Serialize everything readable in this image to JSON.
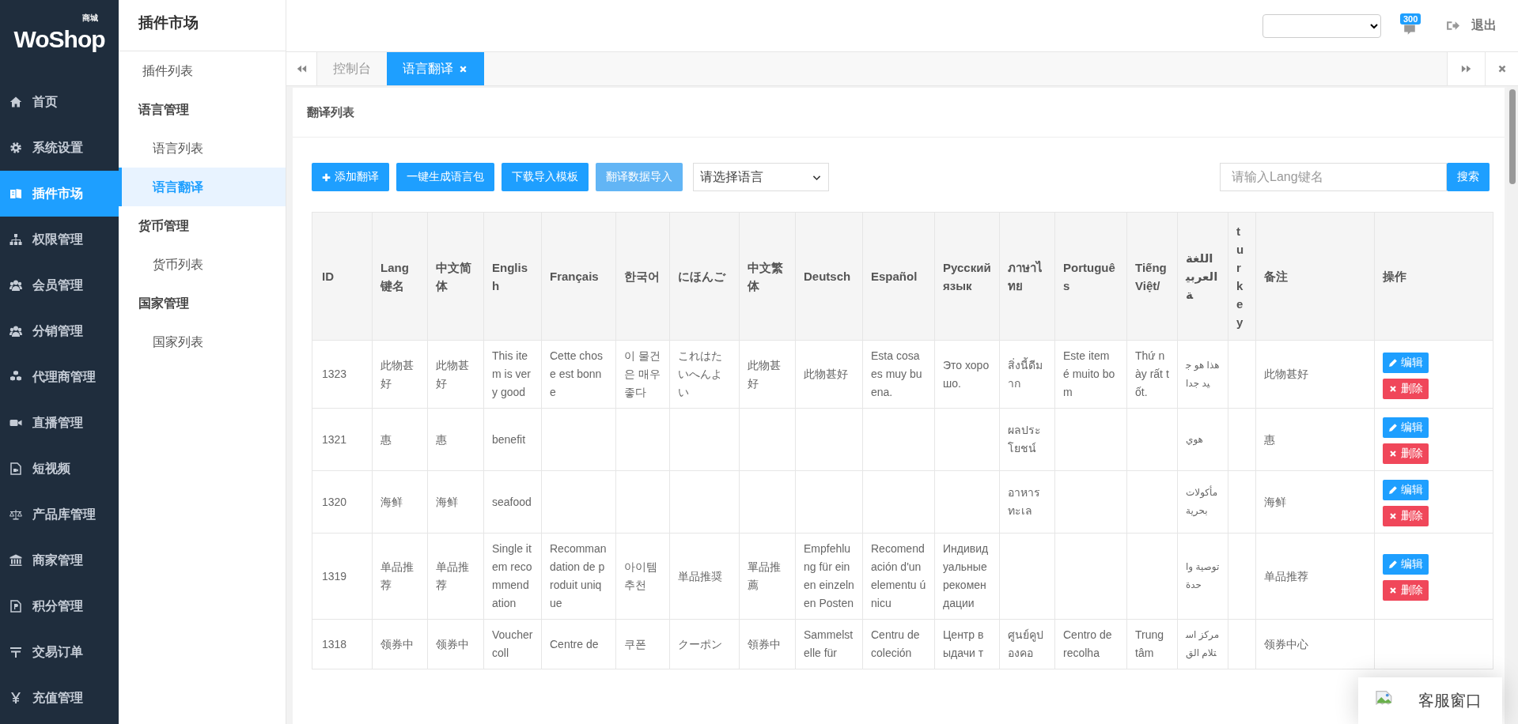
{
  "logo": {
    "text": "WoShop",
    "badge": "商城"
  },
  "sidebar": {
    "items": [
      {
        "label": "首页",
        "selected": false
      },
      {
        "label": "系统设置",
        "selected": false
      },
      {
        "label": "插件市场",
        "selected": true
      },
      {
        "label": "权限管理",
        "selected": false
      },
      {
        "label": "会员管理",
        "selected": false
      },
      {
        "label": "分销管理",
        "selected": false
      },
      {
        "label": "代理商管理",
        "selected": false
      },
      {
        "label": "直播管理",
        "selected": false
      },
      {
        "label": "短视频",
        "selected": false
      },
      {
        "label": "产品库管理",
        "selected": false
      },
      {
        "label": "商家管理",
        "selected": false
      },
      {
        "label": "积分管理",
        "selected": false
      },
      {
        "label": "交易订单",
        "selected": false
      },
      {
        "label": "充值管理",
        "selected": false
      }
    ]
  },
  "subnav": {
    "title": "插件市场",
    "sections": [
      {
        "items": [
          {
            "label": "插件列表",
            "selected": false
          }
        ]
      },
      {
        "heading": "语言管理",
        "items": [
          {
            "label": "语言列表",
            "selected": false
          },
          {
            "label": "语言翻译",
            "selected": true
          }
        ]
      },
      {
        "heading": "货币管理",
        "items": [
          {
            "label": "货币列表",
            "selected": false
          }
        ]
      },
      {
        "heading": "国家管理",
        "items": [
          {
            "label": "国家列表",
            "selected": false
          }
        ]
      }
    ]
  },
  "header": {
    "notification_count": "300",
    "logout": "退出"
  },
  "tabs": [
    {
      "label": "控制台",
      "selected": false,
      "closable": false
    },
    {
      "label": "语言翻译",
      "selected": true,
      "closable": true
    }
  ],
  "panel": {
    "title": "翻译列表",
    "buttons": [
      {
        "label": "添加翻译",
        "kind": "add",
        "disabled": false
      },
      {
        "label": "一键生成语言包",
        "kind": "plain",
        "disabled": false
      },
      {
        "label": "下载导入模板",
        "kind": "plain",
        "disabled": false
      },
      {
        "label": "翻译数据导入",
        "kind": "plain",
        "disabled": true
      }
    ],
    "language_select": {
      "value": "请选择语言"
    },
    "search": {
      "placeholder": "请输入Lang键名",
      "button": "搜索"
    }
  },
  "table": {
    "columns": [
      "ID",
      "Lang键名",
      "中文简体",
      "English",
      "Français",
      "한국어",
      "にほんご",
      "中文繁体",
      "Deutsch",
      "Español",
      "Русский язык",
      "ภาษาไทย",
      "Português",
      "Tiếng Việt/",
      "اللغة العربية",
      "turkey",
      "备注",
      "操作"
    ],
    "rows": [
      {
        "cells": [
          "1323",
          "此物甚好",
          "此物甚好",
          "This item is very good",
          "Cette chose est bonne",
          "이 물건은 매우 좋다",
          "これはたいへんよい",
          "此物甚好",
          "此物甚好",
          "Esta cosa es muy buena.",
          "Это хорошо.",
          "สิ่งนี้ดีมาก",
          "Este item é muito bom",
          "Thứ này rất tốt.",
          "هذا هو جيد جدا",
          null,
          "此物甚好"
        ],
        "actions": [
          {
            "label": "编辑",
            "kind": "edit"
          },
          {
            "label": "删除",
            "kind": "delete"
          }
        ]
      },
      {
        "cells": [
          "1321",
          "惠",
          "惠",
          "benefit",
          null,
          null,
          null,
          null,
          null,
          null,
          null,
          "ผลประโยชน์",
          null,
          null,
          "هوي",
          null,
          "惠"
        ],
        "actions": [
          {
            "label": "编辑",
            "kind": "edit"
          },
          {
            "label": "删除",
            "kind": "delete"
          }
        ]
      },
      {
        "cells": [
          "1320",
          "海鲜",
          "海鲜",
          "seafood",
          null,
          null,
          null,
          null,
          null,
          null,
          null,
          "อาหารทะเล",
          null,
          null,
          "مأكولات بحرية",
          null,
          "海鲜"
        ],
        "actions": [
          {
            "label": "编辑",
            "kind": "edit"
          },
          {
            "label": "删除",
            "kind": "delete"
          }
        ]
      },
      {
        "cells": [
          "1319",
          "单品推荐",
          "单品推荐",
          "Single item recommendation",
          "Recommandation de produit unique",
          "아이템 추천",
          "単品推奨",
          "單品推薦",
          "Empfehlung für einen einzelnen Posten",
          "Recomendación d'un elementu únicu",
          "Индивидуальные рекомендации",
          null,
          null,
          null,
          "توصية واحدة",
          null,
          "单品推荐"
        ],
        "actions": [
          {
            "label": "编辑",
            "kind": "edit"
          },
          {
            "label": "删除",
            "kind": "delete"
          }
        ]
      },
      {
        "cells": [
          "1318",
          "领券中",
          "领券中",
          "Voucher coll",
          "Centre de",
          "쿠폰",
          "クーポン",
          "領券中",
          "Sammelstelle für",
          "Centru de coleción",
          "Центр выдачи т",
          "ศูนย์คูปองคอ",
          "Centro de recolha",
          "Trung tâm",
          "مركز استلام الق",
          null,
          "领券中心"
        ],
        "actions": []
      }
    ]
  },
  "chat_widget": {
    "label": "客服窗口"
  }
}
